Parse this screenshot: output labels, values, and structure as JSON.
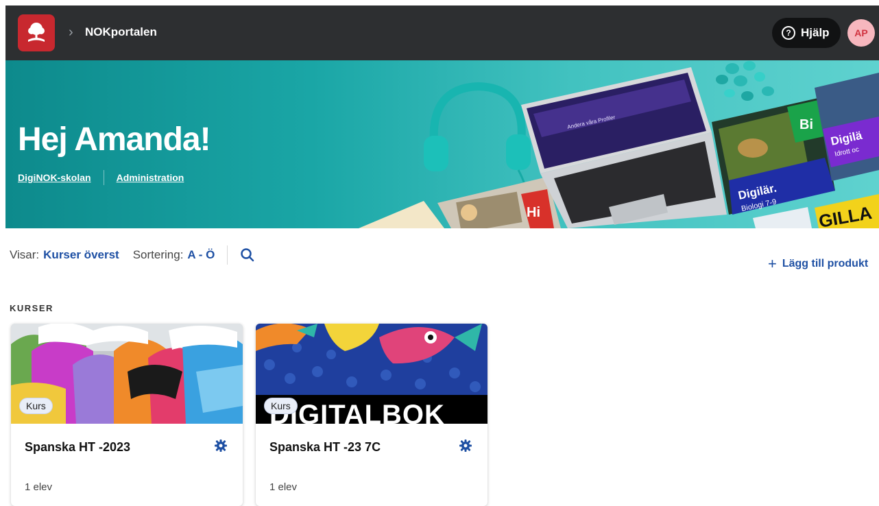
{
  "topbar": {
    "breadcrumb_title": "NOKportalen",
    "help_label": "Hjälp",
    "avatar_initials": "AP",
    "colors": {
      "bar": "#2d2f31",
      "logo": "#c8282f",
      "avatar_bg": "#f7b7be"
    }
  },
  "banner": {
    "greeting": "Hej Amanda!",
    "links": [
      "DigiNOK-skolan",
      "Administration"
    ],
    "laptop_screen_text": "Andera våra Profiler",
    "book_tiles": [
      {
        "tag": "Hi",
        "color": "#d8312a"
      },
      {
        "tag": "Bi",
        "color": "#1aa34a"
      },
      {
        "series": "Digilär.",
        "subject": "Biologi 7-9",
        "color": "#1f2ea6"
      },
      {
        "series": "Digilä",
        "subject": "Idrott oc",
        "color": "#7a2bd0"
      },
      {
        "tag": "GILLA",
        "color": "#f2d21b"
      }
    ]
  },
  "toolbar": {
    "showing_label": "Visar:",
    "showing_value": "Kurser överst",
    "sort_label": "Sortering:",
    "sort_value": "A - Ö",
    "search_icon": "search-icon",
    "add_product_label": "Lägg till produkt",
    "accent": "#1d4fa3"
  },
  "section": {
    "label": "KURSER"
  },
  "courses": [
    {
      "badge": "Kurs",
      "title": "Spanska HT -2023",
      "students": "1 elev",
      "image": "graffiti"
    },
    {
      "badge": "Kurs",
      "title": "Spanska HT -23 7C",
      "students": "1 elev",
      "image": "fish-digitalbok",
      "image_text": "DIGITALBOK"
    }
  ]
}
